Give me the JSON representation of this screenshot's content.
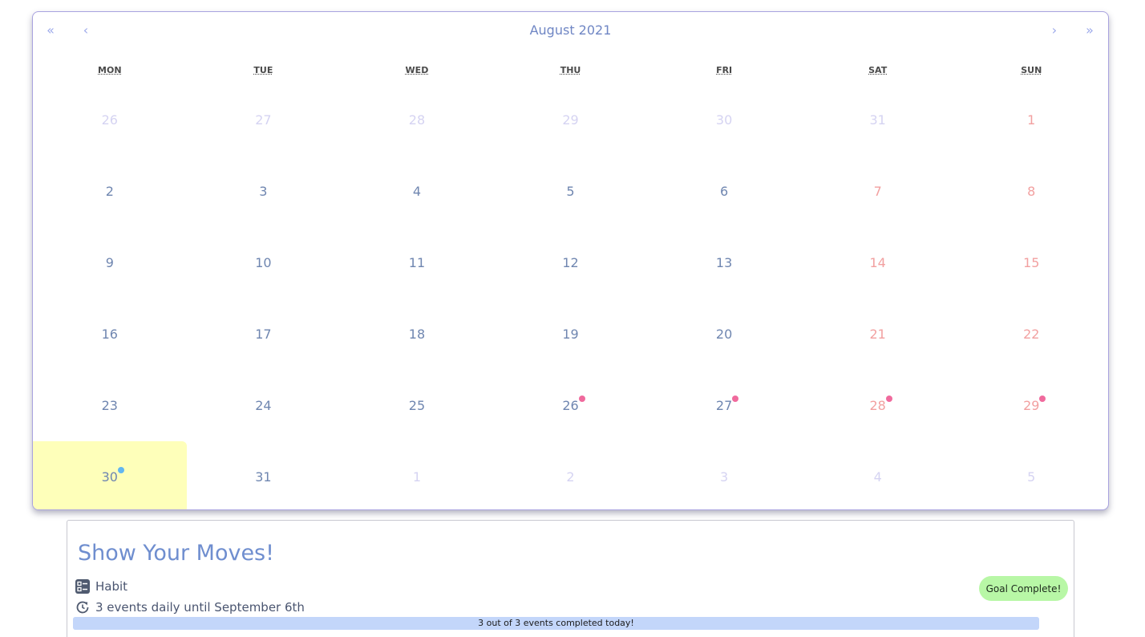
{
  "calendar": {
    "nav": {
      "prev_year": "«",
      "prev_month": "‹",
      "next_month": "›",
      "next_year": "»"
    },
    "month_label": "August 2021",
    "weekdays": [
      "MON",
      "TUE",
      "WED",
      "THU",
      "FRI",
      "SAT",
      "SUN"
    ],
    "weeks": [
      [
        {
          "day": "26",
          "type": "other",
          "weekend": false,
          "dot": null
        },
        {
          "day": "27",
          "type": "other",
          "weekend": false,
          "dot": null
        },
        {
          "day": "28",
          "type": "other",
          "weekend": false,
          "dot": null
        },
        {
          "day": "29",
          "type": "other",
          "weekend": false,
          "dot": null
        },
        {
          "day": "30",
          "type": "other",
          "weekend": false,
          "dot": null
        },
        {
          "day": "31",
          "type": "other",
          "weekend": false,
          "dot": null
        },
        {
          "day": "1",
          "type": "cur",
          "weekend": true,
          "dot": null
        }
      ],
      [
        {
          "day": "2",
          "type": "cur",
          "weekend": false,
          "dot": null
        },
        {
          "day": "3",
          "type": "cur",
          "weekend": false,
          "dot": null
        },
        {
          "day": "4",
          "type": "cur",
          "weekend": false,
          "dot": null
        },
        {
          "day": "5",
          "type": "cur",
          "weekend": false,
          "dot": null
        },
        {
          "day": "6",
          "type": "cur",
          "weekend": false,
          "dot": null
        },
        {
          "day": "7",
          "type": "cur",
          "weekend": true,
          "dot": null
        },
        {
          "day": "8",
          "type": "cur",
          "weekend": true,
          "dot": null
        }
      ],
      [
        {
          "day": "9",
          "type": "cur",
          "weekend": false,
          "dot": null
        },
        {
          "day": "10",
          "type": "cur",
          "weekend": false,
          "dot": null
        },
        {
          "day": "11",
          "type": "cur",
          "weekend": false,
          "dot": null
        },
        {
          "day": "12",
          "type": "cur",
          "weekend": false,
          "dot": null
        },
        {
          "day": "13",
          "type": "cur",
          "weekend": false,
          "dot": null
        },
        {
          "day": "14",
          "type": "cur",
          "weekend": true,
          "dot": null
        },
        {
          "day": "15",
          "type": "cur",
          "weekend": true,
          "dot": null
        }
      ],
      [
        {
          "day": "16",
          "type": "cur",
          "weekend": false,
          "dot": null
        },
        {
          "day": "17",
          "type": "cur",
          "weekend": false,
          "dot": null
        },
        {
          "day": "18",
          "type": "cur",
          "weekend": false,
          "dot": null
        },
        {
          "day": "19",
          "type": "cur",
          "weekend": false,
          "dot": null
        },
        {
          "day": "20",
          "type": "cur",
          "weekend": false,
          "dot": null
        },
        {
          "day": "21",
          "type": "cur",
          "weekend": true,
          "dot": null
        },
        {
          "day": "22",
          "type": "cur",
          "weekend": true,
          "dot": null
        }
      ],
      [
        {
          "day": "23",
          "type": "cur",
          "weekend": false,
          "dot": null
        },
        {
          "day": "24",
          "type": "cur",
          "weekend": false,
          "dot": null
        },
        {
          "day": "25",
          "type": "cur",
          "weekend": false,
          "dot": null
        },
        {
          "day": "26",
          "type": "cur",
          "weekend": false,
          "dot": "pink"
        },
        {
          "day": "27",
          "type": "cur",
          "weekend": false,
          "dot": "pink"
        },
        {
          "day": "28",
          "type": "cur",
          "weekend": true,
          "dot": "pink"
        },
        {
          "day": "29",
          "type": "cur",
          "weekend": true,
          "dot": "pink"
        }
      ],
      [
        {
          "day": "30",
          "type": "today",
          "weekend": false,
          "dot": "blue"
        },
        {
          "day": "31",
          "type": "cur",
          "weekend": false,
          "dot": null
        },
        {
          "day": "1",
          "type": "other",
          "weekend": false,
          "dot": null
        },
        {
          "day": "2",
          "type": "other",
          "weekend": false,
          "dot": null
        },
        {
          "day": "3",
          "type": "other",
          "weekend": false,
          "dot": null
        },
        {
          "day": "4",
          "type": "other",
          "weekend": false,
          "dot": null
        },
        {
          "day": "5",
          "type": "other",
          "weekend": false,
          "dot": null
        }
      ]
    ],
    "colors": {
      "border": "#a9a3df",
      "day_text": "#6f86b0",
      "weekend_text": "#f2a0a0",
      "other_month_text": "#d5d3f2",
      "today_bg": "#feffba",
      "event_dot_pink": "#f06a9d",
      "event_dot_blue": "#62b6f0"
    }
  },
  "event_panel": {
    "title": "Show Your Moves!",
    "type_icon": "checklist-icon",
    "type_label": "Habit",
    "recurrence_icon": "repeat-clock-icon",
    "recurrence_label": "3 events daily until September 6th",
    "goal_badge": "Goal Complete!",
    "progress": {
      "completed": 3,
      "total": 3,
      "text": "3 out of 3 events completed today!"
    },
    "colors": {
      "title": "#6f8ecf",
      "goal_badge_bg": "#b8f7a6",
      "progress_bg": "#cfe0fb"
    }
  }
}
